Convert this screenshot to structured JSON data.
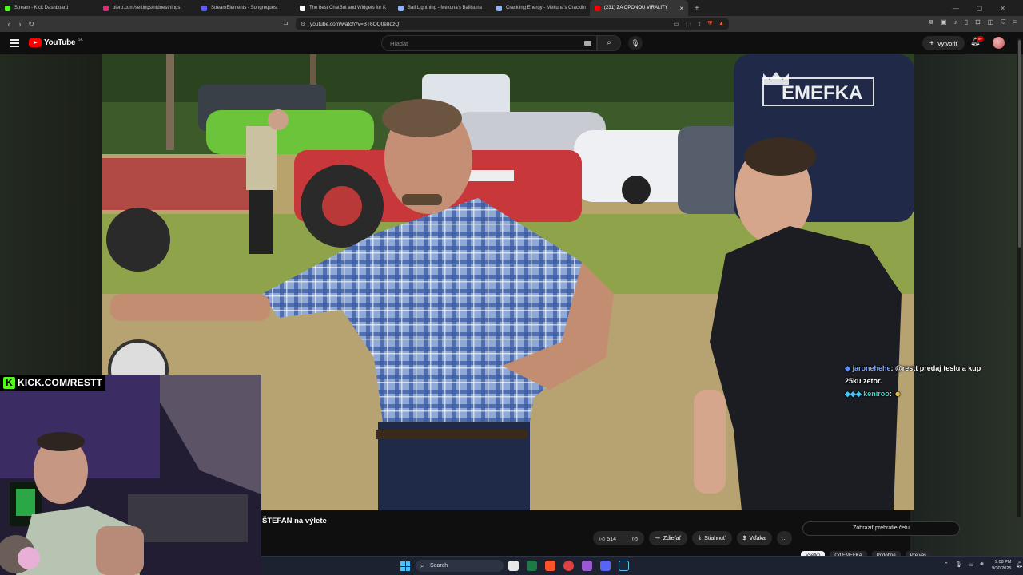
{
  "browser": {
    "tabs": [
      {
        "title": "Stream - Kick Dashboard",
        "color": "#53fc18"
      },
      {
        "title": "blerp.com/settings/ntdoesthings",
        "color": "#e0287a"
      },
      {
        "title": "StreamElements - Songrequest",
        "color": "#5c5cff"
      },
      {
        "title": "The best ChatBot and Widgets for K",
        "color": "#ffffff"
      },
      {
        "title": "Ball Lightning - Mekuna's Ballisuna",
        "color": "#8ab4ff"
      },
      {
        "title": "Crackling Energy - Mekuna's Cracklin",
        "color": "#8ab4ff"
      },
      {
        "title": "(231) ZA OPONOU VIRALITY",
        "color": "#ff0000",
        "active": true
      }
    ],
    "url": "youtube.com/watch?v=BT6OQ0e8dzQ"
  },
  "youtube": {
    "logo_text": "YouTube",
    "country": "SK",
    "search_placeholder": "Hľadať",
    "create_label": "Vytvoriť",
    "notif_count": "9+"
  },
  "video": {
    "watermark": "EMEFKA",
    "title": "ŠTEFAN na výlete",
    "likes": "514",
    "share_label": "Zdieľať",
    "download_label": "Stiahnuť",
    "thanks_label": "Vďaka",
    "more_label": "…",
    "chat_replay_label": "Zobraziť prehratie četu",
    "chips": [
      "Všetko",
      "Od EMEFKA",
      "Podobné",
      "Pre vás"
    ]
  },
  "stream_overlay": {
    "kick_url": "KICK.COM/RESTT",
    "chat": [
      {
        "user": "jaronehehe",
        "message": "@restt predaj teslu a kup 25ku zetor."
      },
      {
        "user": "keniroo",
        "message": ""
      }
    ]
  },
  "taskbar": {
    "search_label": "Search",
    "time": "9:08 PM",
    "date": "9/30/2025"
  },
  "colors": {
    "accent": "#ff0000",
    "kick_green": "#53fc18",
    "background": "#0f0f0f"
  }
}
